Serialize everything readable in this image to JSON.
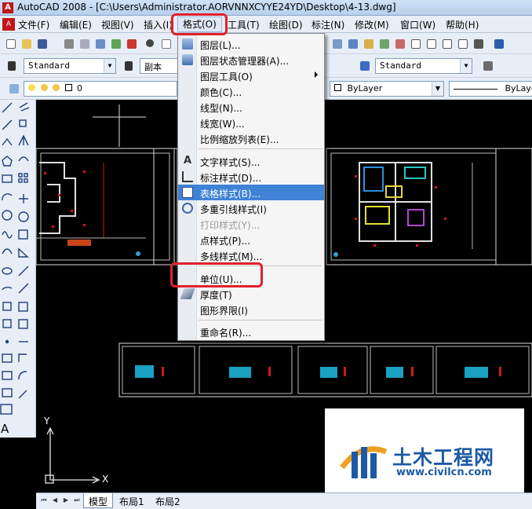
{
  "window": {
    "title": "AutoCAD 2008 - [C:\\Users\\Administrator.AORVNNXCYYE24YD\\Desktop\\4-13.dwg]"
  },
  "menubar": {
    "items": [
      "文件(F)",
      "编辑(E)",
      "视图(V)",
      "插入(I)",
      "格式(O)",
      "工具(T)",
      "绘图(D)",
      "标注(N)",
      "修改(M)",
      "窗口(W)",
      "帮助(H)"
    ],
    "active_index": 4
  },
  "toolbar2": {
    "text_style": "Standard",
    "dim_style": "副本",
    "table_style": "Standard"
  },
  "toolbar3": {
    "layer": "0",
    "color": "ByLayer",
    "linetype": "ByLaye"
  },
  "format_menu": {
    "items": [
      {
        "label": "图层(L)...",
        "icon": "layers-icon"
      },
      {
        "label": "图层状态管理器(A)...",
        "icon": "layer-state-icon"
      },
      {
        "label": "图层工具(O)",
        "submenu": true
      },
      {
        "label": "颜色(C)..."
      },
      {
        "label": "线型(N)..."
      },
      {
        "label": "线宽(W)..."
      },
      {
        "label": "比例缩放列表(E)..."
      },
      {
        "label": "文字样式(S)...",
        "icon": "text-style-icon"
      },
      {
        "label": "标注样式(D)...",
        "icon": "dim-style-icon"
      },
      {
        "label": "表格样式(B)...",
        "icon": "table-style-icon",
        "highlighted": true
      },
      {
        "label": "多重引线样式(I)",
        "icon": "mleader-style-icon"
      },
      {
        "label": "打印样式(Y)...",
        "disabled": true
      },
      {
        "label": "点样式(P)..."
      },
      {
        "label": "多线样式(M)..."
      },
      {
        "label": "单位(U)...",
        "circled": true
      },
      {
        "label": "厚度(T)",
        "icon": "thickness-icon"
      },
      {
        "label": "图形界限(I)"
      },
      {
        "label": "重命名(R)..."
      }
    ]
  },
  "layout_tabs": [
    "模型",
    "布局1",
    "布局2"
  ],
  "ucs": {
    "x_label": "X",
    "y_label": "Y"
  },
  "watermark": {
    "name": "土木工程网",
    "url": "www.civilcn.com"
  },
  "colors": {
    "highlight": "#3f82d6",
    "annotation_red": "#e0202c",
    "menu_bg": "#f5f5f5",
    "toolbar_bg": "#e8eef7"
  }
}
